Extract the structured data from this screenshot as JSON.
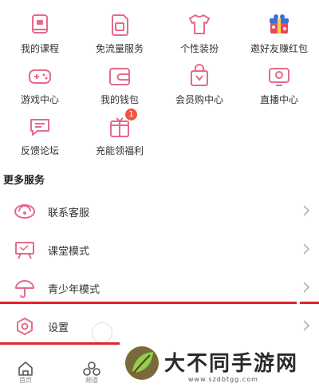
{
  "accent": "#e46b8a",
  "services_grid": [
    {
      "name": "course",
      "label": "我的课程",
      "icon": "course-icon"
    },
    {
      "name": "free-data",
      "label": "免流量服务",
      "icon": "sim-card-icon"
    },
    {
      "name": "outfit",
      "label": "个性装扮",
      "icon": "tshirt-icon"
    },
    {
      "name": "invite",
      "label": "邀好友赚红包",
      "icon": "gift-box-icon"
    },
    {
      "name": "game",
      "label": "游戏中心",
      "icon": "gamepad-icon"
    },
    {
      "name": "wallet",
      "label": "我的钱包",
      "icon": "wallet-icon"
    },
    {
      "name": "vip-shop",
      "label": "会员购中心",
      "icon": "shopping-bag-icon"
    },
    {
      "name": "live",
      "label": "直播中心",
      "icon": "tv-icon"
    },
    {
      "name": "forum",
      "label": "反馈论坛",
      "icon": "chat-icon"
    },
    {
      "name": "welfare",
      "label": "充能领福利",
      "icon": "gift-icon",
      "badge": "1"
    }
  ],
  "more_services": {
    "title": "更多服务",
    "items": [
      {
        "name": "customer-service",
        "label": "联系客服",
        "icon": "headset-icon"
      },
      {
        "name": "classroom-mode",
        "label": "课堂模式",
        "icon": "blackboard-icon"
      },
      {
        "name": "teen-mode",
        "label": "青少年模式",
        "icon": "umbrella-icon"
      },
      {
        "name": "settings",
        "label": "设置",
        "icon": "settings-icon"
      }
    ]
  },
  "tabbar": {
    "items": [
      {
        "name": "home",
        "label": "首页",
        "icon": "home-icon"
      },
      {
        "name": "channel",
        "label": "频道",
        "icon": "circles-icon"
      }
    ]
  },
  "watermark": {
    "title": "大不同手游网",
    "url": "www.szdbtgg.com"
  }
}
